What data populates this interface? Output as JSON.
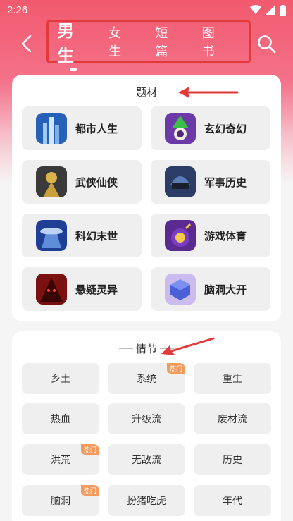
{
  "status_bar": {
    "time": "2:26"
  },
  "header": {
    "tabs": [
      {
        "label": "男生",
        "active": true
      },
      {
        "label": "女生",
        "active": false
      },
      {
        "label": "短篇",
        "active": false
      },
      {
        "label": "图书",
        "active": false
      }
    ]
  },
  "genres_section": {
    "title": "题材",
    "items": [
      {
        "label": "都市人生",
        "icon": "city-skyline-icon"
      },
      {
        "label": "玄幻奇幻",
        "icon": "wizard-hat-icon"
      },
      {
        "label": "武侠仙侠",
        "icon": "warrior-icon"
      },
      {
        "label": "军事历史",
        "icon": "helmet-icon"
      },
      {
        "label": "科幻末世",
        "icon": "ufo-icon"
      },
      {
        "label": "游戏体育",
        "icon": "skull-bomb-icon"
      },
      {
        "label": "悬疑灵异",
        "icon": "demon-icon"
      },
      {
        "label": "脑洞大开",
        "icon": "cube-icon"
      }
    ]
  },
  "plots_section": {
    "title": "情节",
    "hot_label": "热门",
    "items": [
      {
        "label": "乡土",
        "hot": false
      },
      {
        "label": "系统",
        "hot": true
      },
      {
        "label": "重生",
        "hot": false
      },
      {
        "label": "热血",
        "hot": false
      },
      {
        "label": "升级流",
        "hot": false
      },
      {
        "label": "废材流",
        "hot": false
      },
      {
        "label": "洪荒",
        "hot": true
      },
      {
        "label": "无敌流",
        "hot": false
      },
      {
        "label": "历史",
        "hot": false
      },
      {
        "label": "脑洞",
        "hot": true
      },
      {
        "label": "扮猪吃虎",
        "hot": false
      },
      {
        "label": "年代",
        "hot": false
      }
    ]
  },
  "colors": {
    "accent": "#f25a6e",
    "annotation": "#e23a3a",
    "hot_badge": "#f39a5c"
  }
}
